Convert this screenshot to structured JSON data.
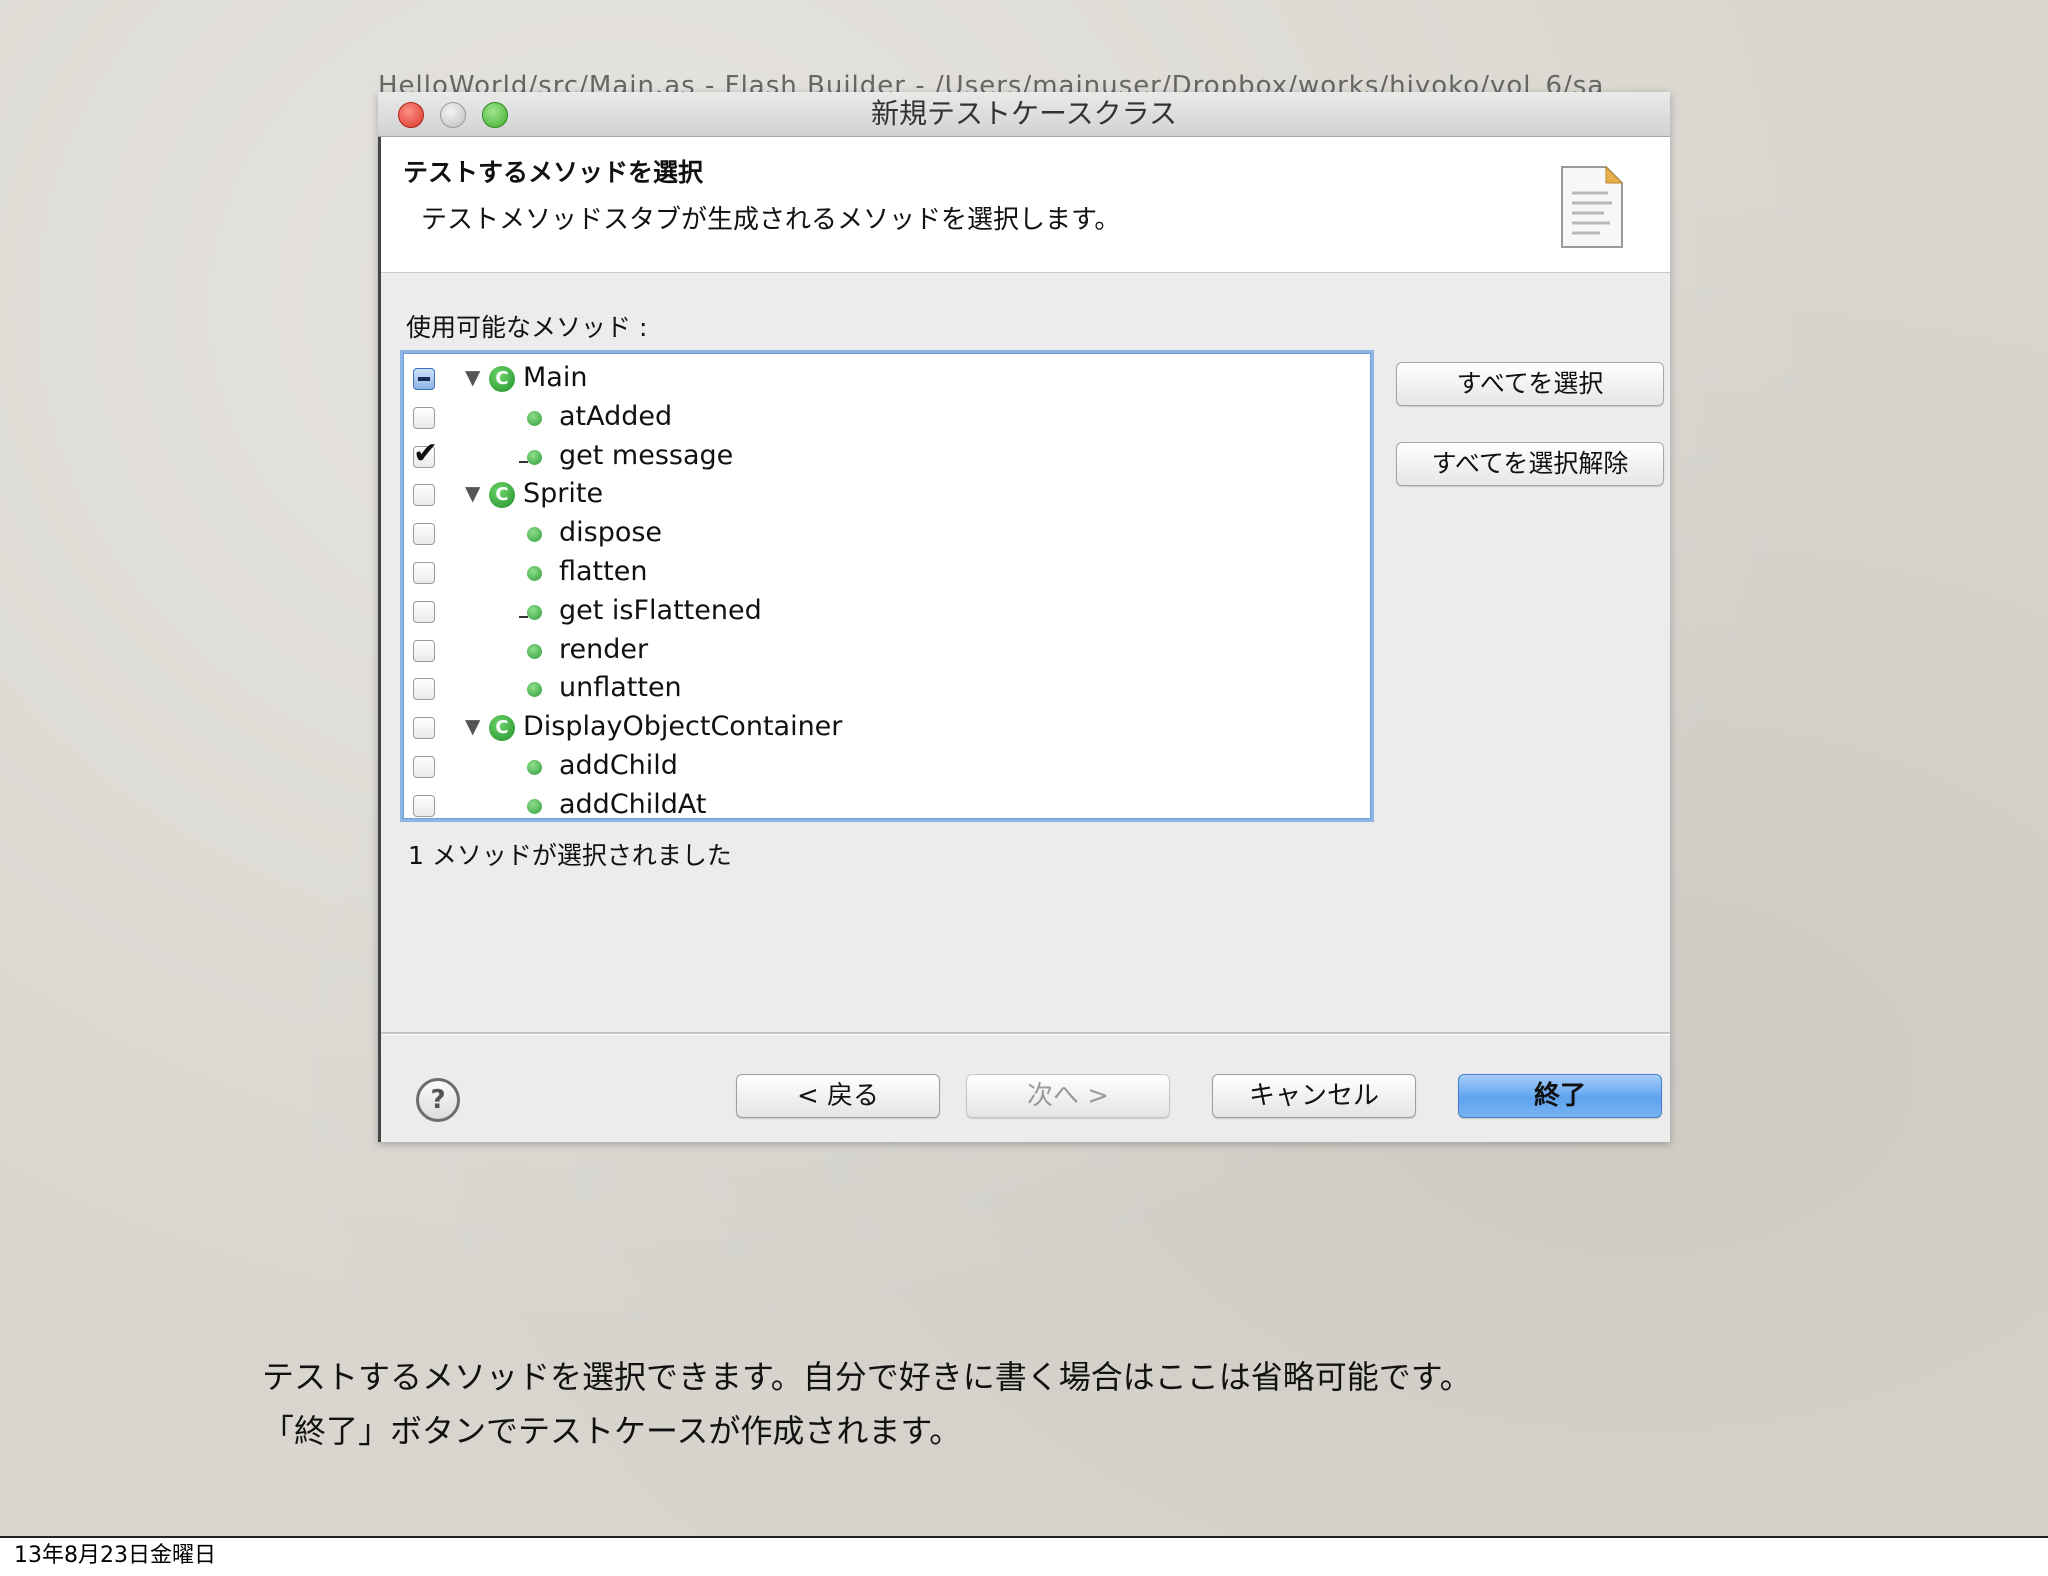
{
  "background_window_title": "HelloWorld/src/Main.as - Flash Builder - /Users/mainuser/Dropbox/works/hiyoko/vol_6/sa",
  "dialog": {
    "title": "新規テストケースクラス",
    "header_title": "テストするメソッドを選択",
    "header_description": "テストメソッドスタブが生成されるメソッドを選択します。",
    "available_label": "使用可能なメソッド :",
    "tree": [
      {
        "type": "class",
        "label": "Main",
        "state": "partial"
      },
      {
        "type": "method",
        "label": "atAdded",
        "checked": false,
        "getter": false
      },
      {
        "type": "method",
        "label": "get message",
        "checked": true,
        "getter": true
      },
      {
        "type": "class",
        "label": "Sprite",
        "state": "unchecked"
      },
      {
        "type": "method",
        "label": "dispose",
        "checked": false,
        "getter": false
      },
      {
        "type": "method",
        "label": "flatten",
        "checked": false,
        "getter": false
      },
      {
        "type": "method",
        "label": "get isFlattened",
        "checked": false,
        "getter": true
      },
      {
        "type": "method",
        "label": "render",
        "checked": false,
        "getter": false
      },
      {
        "type": "method",
        "label": "unflatten",
        "checked": false,
        "getter": false
      },
      {
        "type": "class",
        "label": "DisplayObjectContainer",
        "state": "unchecked"
      },
      {
        "type": "method",
        "label": "addChild",
        "checked": false,
        "getter": false
      },
      {
        "type": "method",
        "label": "addChildAt",
        "checked": false,
        "getter": false
      }
    ],
    "select_all_label": "すべてを選択",
    "deselect_all_label": "すべてを選択解除",
    "status": "1 メソッドが選択されました",
    "back_label": "< 戻る",
    "next_label": "次へ >",
    "cancel_label": "キャンセル",
    "finish_label": "終了",
    "help_glyph": "?",
    "class_icon_glyph": "C",
    "twisty_glyph": "▼",
    "check_glyph": "✔"
  },
  "caption": {
    "line1": "テストするメソッドを選択できます。自分で好きに書く場合はここは省略可能です。",
    "line2": "「終了」ボタンでテストケースが作成されます。"
  },
  "footer_date": "13年8月23日金曜日",
  "colors": {
    "tree_border": "#8db4e3",
    "default_button": "#5ea3ef",
    "class_icon": "#1f8e2a"
  }
}
